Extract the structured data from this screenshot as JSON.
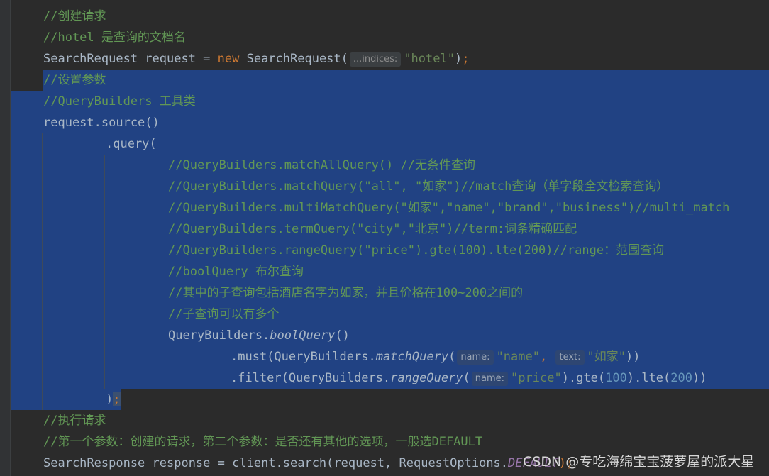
{
  "editor": {
    "lines": {
      "l1": "//创建请求",
      "l2": "//hotel 是查询的文档名",
      "l3_a": "SearchRequest request = ",
      "l3_kw": "new",
      "l3_b": " SearchRequest(",
      "l3_hint": "...indices:",
      "l3_str": "\"hotel\"",
      "l3_c": ")",
      "l3_semi": ";",
      "l4": "//设置参数",
      "l5": "//QueryBuilders 工具类",
      "l6": "request.source()",
      "l7": ".query(",
      "l8": "//QueryBuilders.matchAllQuery() //无条件查询",
      "l9": "//QueryBuilders.matchQuery(\"all\", \"如家\")//match查询（单字段全文检索查询）",
      "l10": "//QueryBuilders.multiMatchQuery(\"如家\",\"name\",\"brand\",\"business\")//multi_match",
      "l11": "//QueryBuilders.termQuery(\"city\",\"北京\")//term:词条精确匹配",
      "l12": "//QueryBuilders.rangeQuery(\"price\").gte(100).lte(200)//range：范围查询",
      "l13": "//boolQuery 布尔查询",
      "l14": "//其中的子查询包括酒店名字为如家，并且价格在100~200之间的",
      "l15": "//子查询可以有多个",
      "l16_a": "QueryBuilders.",
      "l16_i": "boolQuery",
      "l16_b": "()",
      "l17_a": ".must(QueryBuilders.",
      "l17_i": "matchQuery",
      "l17_b": "(",
      "l17_hint1": "name:",
      "l17_s1": "\"name\"",
      "l17_comma": ", ",
      "l17_hint2": "text:",
      "l17_s2": "\"如家\"",
      "l17_c": "))",
      "l18_a": ".filter(QueryBuilders.",
      "l18_i": "rangeQuery",
      "l18_b": "(",
      "l18_hint": "name:",
      "l18_s": "\"price\"",
      "l18_c": ").gte(",
      "l18_n1": "100",
      "l18_d": ").lte(",
      "l18_n2": "200",
      "l18_e": "))",
      "l19_a": ")",
      "l19_semi": ";",
      "l20": "//执行请求",
      "l21": "//第一个参数：创建的请求，第二个参数：是否还有其他的选项，一般选DEFAULT",
      "l22_a": "SearchResponse response = client.search(request, RequestOptions.",
      "l22_b": "DEFAULT",
      "l22_c": ");"
    }
  },
  "watermark": "CSDN @专吃海绵宝宝菠萝屋的派大星",
  "colors": {
    "background": "#2b2b2b",
    "selection": "#214283",
    "comment": "#629755",
    "keyword": "#cc7832",
    "string": "#6a8759",
    "number": "#6897bb",
    "default_text": "#a9b7c6"
  }
}
